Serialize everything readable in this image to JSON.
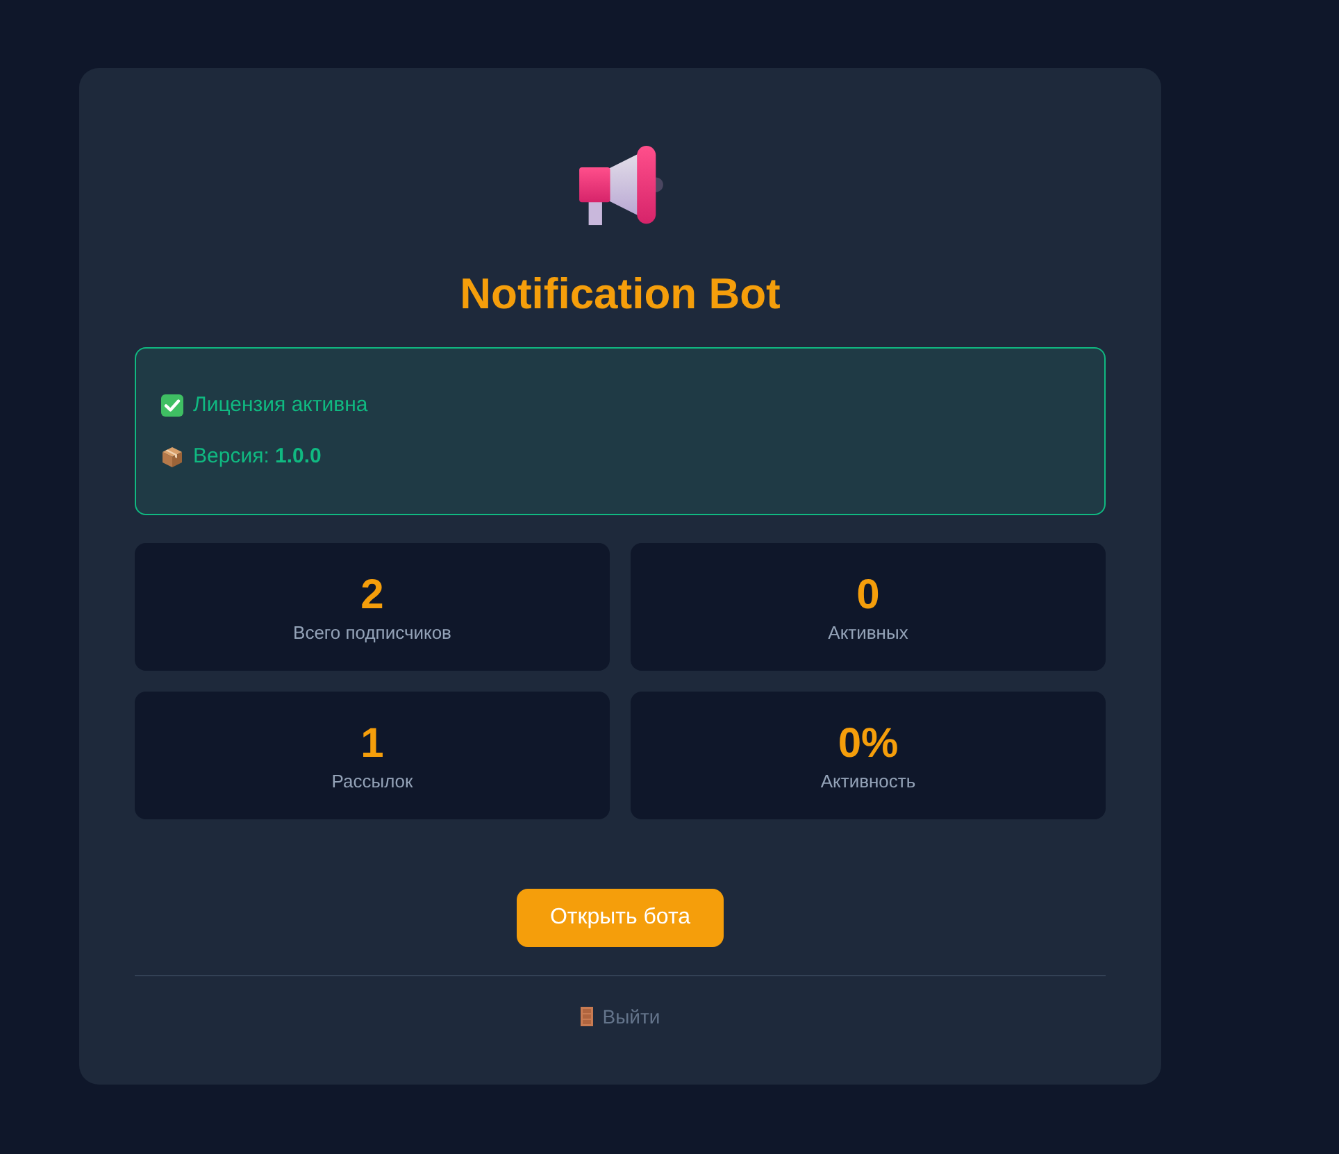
{
  "title": "Notification Bot",
  "license": {
    "status": "Лицензия активна",
    "active": true,
    "version": "Версия: **1.0.0**"
  },
  "stats": [
    {
      "value": "2",
      "label": "Всего подписчиков"
    },
    {
      "value": "0",
      "label": "Активных"
    },
    {
      "value": "1",
      "label": "Рассылок"
    },
    {
      "value": "0%",
      "label": "Активность"
    }
  ],
  "open_button": "Открыть бота",
  "logout": "Выйти"
}
